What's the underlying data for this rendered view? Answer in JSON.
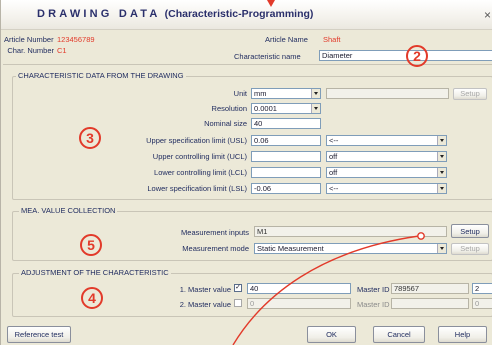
{
  "window": {
    "title_main": "DRAWING DATA",
    "title_sub": "(Characteristic-Programming)",
    "close_glyph": "×"
  },
  "header": {
    "article_number_label": "Article Number",
    "article_number_value": "123456789",
    "char_number_label": "Char. Number",
    "char_number_value": "C1",
    "article_name_label": "Article Name",
    "article_name_value": "Shaft",
    "characteristic_name_label": "Characteristic name",
    "characteristic_name_value": "Diameter"
  },
  "drawing": {
    "group_title": "CHARACTERISTIC DATA FROM THE DRAWING",
    "unit_label": "Unit",
    "unit_value": "mm",
    "setup_label": "Setup",
    "resolution_label": "Resolution",
    "resolution_value": "0.0001",
    "nominal_label": "Nominal size",
    "nominal_value": "40",
    "usl_label": "Upper specification limit (USL)",
    "usl_value": "0.06",
    "usl_mode": "<--",
    "ucl_label": "Upper controlling limit (UCL)",
    "ucl_mode": "off",
    "lcl_label": "Lower controlling limit (LCL)",
    "lcl_mode": "off",
    "lsl_label": "Lower specification limit (LSL)",
    "lsl_value": "-0.06",
    "lsl_mode": "<--"
  },
  "measurement": {
    "group_title": "MEA. VALUE COLLECTION",
    "inputs_label": "Measurement inputs",
    "inputs_value": "M1",
    "setup_label": "Setup",
    "mode_label": "Measurement mode",
    "mode_value": "Static Measurement",
    "setup2_label": "Setup"
  },
  "adjustment": {
    "group_title": "ADJUSTMENT OF THE CHARACTERISTIC",
    "master1_label": "1. Master value",
    "master1_checked": "✓",
    "master1_value": "40",
    "master_id1_label": "Master ID",
    "master_id1_value": "789567",
    "master_id1_count": "2",
    "master2_label": "2. Master value",
    "master2_value": "0",
    "master_id2_label": "Master ID",
    "master_id2_count": "0"
  },
  "footer": {
    "reference_test": "Reference test",
    "ok": "OK",
    "cancel": "Cancel",
    "help": "Help"
  },
  "annotations": {
    "c2": "2",
    "c3": "3",
    "c4": "4",
    "c5": "5",
    "color": "#e23a2a"
  }
}
